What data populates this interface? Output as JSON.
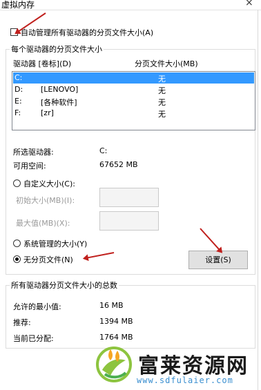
{
  "window": {
    "title": "虚拟内存",
    "close_glyph": "×"
  },
  "auto_manage": {
    "label": "自动管理所有驱动器的分页文件大小(A)",
    "checked": false
  },
  "per_drive_group": {
    "title": "每个驱动器的分页文件大小",
    "col_drive": "驱动器 [卷标](D)",
    "col_size": "分页文件大小(MB)",
    "rows": [
      {
        "drive": "C:",
        "label": "",
        "size": "无",
        "selected": true
      },
      {
        "drive": "D:",
        "label": "[LENOVO]",
        "size": "无",
        "selected": false
      },
      {
        "drive": "E:",
        "label": "[各种软件]",
        "size": "无",
        "selected": false
      },
      {
        "drive": "F:",
        "label": "[zr]",
        "size": "无",
        "selected": false
      }
    ],
    "selected_drive_label": "所选驱动器:",
    "selected_drive_value": "C:",
    "free_space_label": "可用空间:",
    "free_space_value": "67652 MB",
    "custom_size_label": "自定义大小(C):",
    "initial_size_label": "初始大小(MB)(I):",
    "max_size_label": "最大值(MB)(X):",
    "system_managed_label": "系统管理的大小(Y)",
    "no_paging_label": "无分页文件(N)",
    "set_button": "设置(S)",
    "selected_option": "no_paging"
  },
  "totals_group": {
    "title": "所有驱动器分页文件大小的总数",
    "min_label": "允许的最小值:",
    "min_value": "16 MB",
    "recommended_label": "推荐:",
    "recommended_value": "1394 MB",
    "current_label": "当前已分配:",
    "current_value": "1764 MB"
  },
  "watermark": {
    "text": "富莱资源网",
    "url": "www.sdfulaier.com"
  },
  "colors": {
    "selection": "#3399ff",
    "annotation_arrow": "#c0201d",
    "watermark_url": "#3a8fd0"
  }
}
